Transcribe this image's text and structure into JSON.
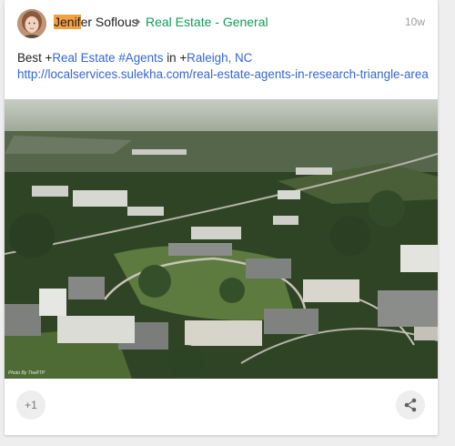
{
  "post": {
    "author": {
      "name_highlight": "Jenif",
      "name_rest": "er Soflous",
      "avatar_icon": "user-avatar-photo"
    },
    "community": "Real Estate - General",
    "timestamp": "10w",
    "text": {
      "prefix": "Best +",
      "tag1": "Real Estate",
      "tag2": "#Agents",
      "in_text": "in +",
      "location": "Raleigh, NC",
      "link": "http://localservices.sulekha.com/real-estate-agents-in-research-triangle-area"
    },
    "photo": {
      "credit": "Photo By TheRTP",
      "description_icon": "aerial-office-park-photo"
    },
    "actions": {
      "plus_one_label": "+1",
      "share_icon": "share-icon"
    }
  },
  "colors": {
    "highlight": "#f5a142",
    "community": "#0f9d58",
    "link": "#3367d6",
    "timestamp": "#9e9e9e"
  }
}
